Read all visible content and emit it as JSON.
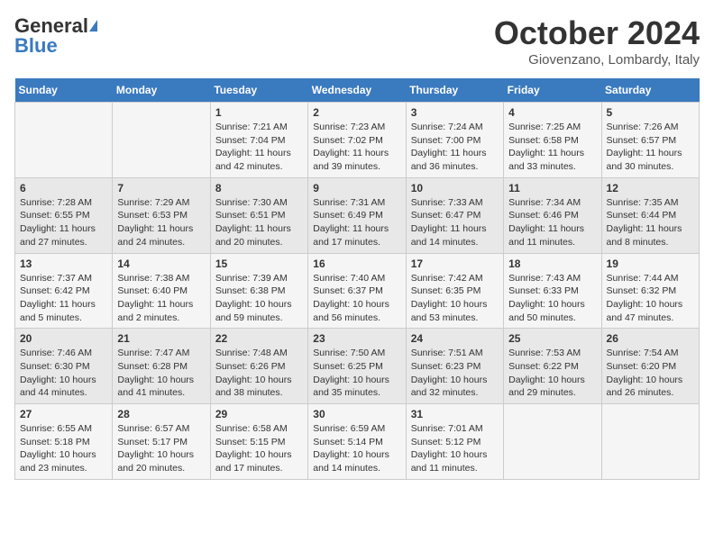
{
  "header": {
    "logo_general": "General",
    "logo_blue": "Blue",
    "month_title": "October 2024",
    "location": "Giovenzano, Lombardy, Italy"
  },
  "days_of_week": [
    "Sunday",
    "Monday",
    "Tuesday",
    "Wednesday",
    "Thursday",
    "Friday",
    "Saturday"
  ],
  "weeks": [
    [
      {
        "day": "",
        "content": ""
      },
      {
        "day": "",
        "content": ""
      },
      {
        "day": "1",
        "content": "Sunrise: 7:21 AM\nSunset: 7:04 PM\nDaylight: 11 hours and 42 minutes."
      },
      {
        "day": "2",
        "content": "Sunrise: 7:23 AM\nSunset: 7:02 PM\nDaylight: 11 hours and 39 minutes."
      },
      {
        "day": "3",
        "content": "Sunrise: 7:24 AM\nSunset: 7:00 PM\nDaylight: 11 hours and 36 minutes."
      },
      {
        "day": "4",
        "content": "Sunrise: 7:25 AM\nSunset: 6:58 PM\nDaylight: 11 hours and 33 minutes."
      },
      {
        "day": "5",
        "content": "Sunrise: 7:26 AM\nSunset: 6:57 PM\nDaylight: 11 hours and 30 minutes."
      }
    ],
    [
      {
        "day": "6",
        "content": "Sunrise: 7:28 AM\nSunset: 6:55 PM\nDaylight: 11 hours and 27 minutes."
      },
      {
        "day": "7",
        "content": "Sunrise: 7:29 AM\nSunset: 6:53 PM\nDaylight: 11 hours and 24 minutes."
      },
      {
        "day": "8",
        "content": "Sunrise: 7:30 AM\nSunset: 6:51 PM\nDaylight: 11 hours and 20 minutes."
      },
      {
        "day": "9",
        "content": "Sunrise: 7:31 AM\nSunset: 6:49 PM\nDaylight: 11 hours and 17 minutes."
      },
      {
        "day": "10",
        "content": "Sunrise: 7:33 AM\nSunset: 6:47 PM\nDaylight: 11 hours and 14 minutes."
      },
      {
        "day": "11",
        "content": "Sunrise: 7:34 AM\nSunset: 6:46 PM\nDaylight: 11 hours and 11 minutes."
      },
      {
        "day": "12",
        "content": "Sunrise: 7:35 AM\nSunset: 6:44 PM\nDaylight: 11 hours and 8 minutes."
      }
    ],
    [
      {
        "day": "13",
        "content": "Sunrise: 7:37 AM\nSunset: 6:42 PM\nDaylight: 11 hours and 5 minutes."
      },
      {
        "day": "14",
        "content": "Sunrise: 7:38 AM\nSunset: 6:40 PM\nDaylight: 11 hours and 2 minutes."
      },
      {
        "day": "15",
        "content": "Sunrise: 7:39 AM\nSunset: 6:38 PM\nDaylight: 10 hours and 59 minutes."
      },
      {
        "day": "16",
        "content": "Sunrise: 7:40 AM\nSunset: 6:37 PM\nDaylight: 10 hours and 56 minutes."
      },
      {
        "day": "17",
        "content": "Sunrise: 7:42 AM\nSunset: 6:35 PM\nDaylight: 10 hours and 53 minutes."
      },
      {
        "day": "18",
        "content": "Sunrise: 7:43 AM\nSunset: 6:33 PM\nDaylight: 10 hours and 50 minutes."
      },
      {
        "day": "19",
        "content": "Sunrise: 7:44 AM\nSunset: 6:32 PM\nDaylight: 10 hours and 47 minutes."
      }
    ],
    [
      {
        "day": "20",
        "content": "Sunrise: 7:46 AM\nSunset: 6:30 PM\nDaylight: 10 hours and 44 minutes."
      },
      {
        "day": "21",
        "content": "Sunrise: 7:47 AM\nSunset: 6:28 PM\nDaylight: 10 hours and 41 minutes."
      },
      {
        "day": "22",
        "content": "Sunrise: 7:48 AM\nSunset: 6:26 PM\nDaylight: 10 hours and 38 minutes."
      },
      {
        "day": "23",
        "content": "Sunrise: 7:50 AM\nSunset: 6:25 PM\nDaylight: 10 hours and 35 minutes."
      },
      {
        "day": "24",
        "content": "Sunrise: 7:51 AM\nSunset: 6:23 PM\nDaylight: 10 hours and 32 minutes."
      },
      {
        "day": "25",
        "content": "Sunrise: 7:53 AM\nSunset: 6:22 PM\nDaylight: 10 hours and 29 minutes."
      },
      {
        "day": "26",
        "content": "Sunrise: 7:54 AM\nSunset: 6:20 PM\nDaylight: 10 hours and 26 minutes."
      }
    ],
    [
      {
        "day": "27",
        "content": "Sunrise: 6:55 AM\nSunset: 5:18 PM\nDaylight: 10 hours and 23 minutes."
      },
      {
        "day": "28",
        "content": "Sunrise: 6:57 AM\nSunset: 5:17 PM\nDaylight: 10 hours and 20 minutes."
      },
      {
        "day": "29",
        "content": "Sunrise: 6:58 AM\nSunset: 5:15 PM\nDaylight: 10 hours and 17 minutes."
      },
      {
        "day": "30",
        "content": "Sunrise: 6:59 AM\nSunset: 5:14 PM\nDaylight: 10 hours and 14 minutes."
      },
      {
        "day": "31",
        "content": "Sunrise: 7:01 AM\nSunset: 5:12 PM\nDaylight: 10 hours and 11 minutes."
      },
      {
        "day": "",
        "content": ""
      },
      {
        "day": "",
        "content": ""
      }
    ]
  ]
}
